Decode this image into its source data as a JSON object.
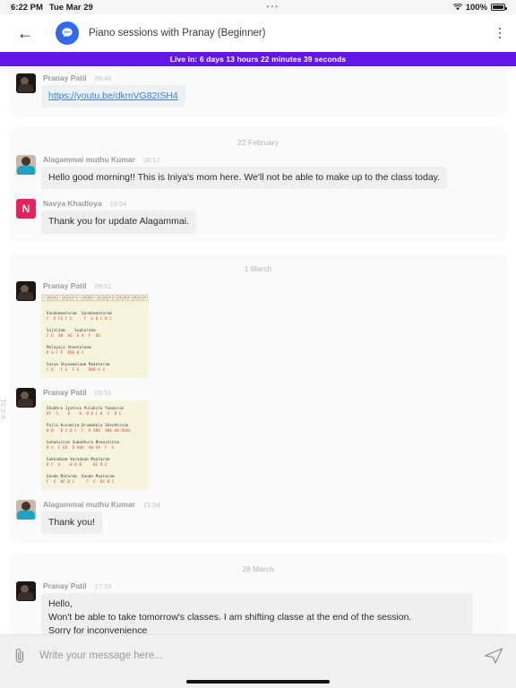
{
  "status_bar": {
    "time": "6:22 PM",
    "date": "Tue Mar 29",
    "center_dots": "•••",
    "battery_pct": "100%"
  },
  "header": {
    "back_icon": "back-arrow-icon",
    "app_icon": "chat-bubble-icon",
    "title": "Piano sessions with Pranay (Beginner)",
    "overflow_icon": "kebab-menu-icon"
  },
  "live_banner": {
    "text": "Live in: 6 days 13 hours 22 minutes 39 seconds",
    "color": "#6415e8"
  },
  "version_tag": "V-2.51",
  "conversation": {
    "groups": [
      {
        "date_label": null,
        "messages": [
          {
            "sender": "Pranay Patil",
            "time": "08:48",
            "avatar": "pranay",
            "type": "link",
            "text": "https://youtu.be/dkmVG82ISH4"
          }
        ]
      },
      {
        "date_label": "22 February",
        "messages": [
          {
            "sender": "Alagammai muthu Kumar",
            "time": "08:17",
            "avatar": "alagammai",
            "type": "text",
            "text": "Hello good morning!! This is Iniya's mom here. We'll not be able to make up to the class today."
          },
          {
            "sender": "Navya Khadloya",
            "time": "18:54",
            "avatar": "navya",
            "avatar_letter": "N",
            "avatar_color": "#e8215b",
            "type": "text",
            "text": "Thank you for update Alagammai."
          }
        ]
      },
      {
        "date_label": "1 March",
        "messages": [
          {
            "sender": "Pranay Patil",
            "time": "09:51",
            "avatar": "pranay",
            "type": "notation",
            "notation_id": "vandemaataram-sheet"
          },
          {
            "sender": "Pranay Patil",
            "time": "09:51",
            "avatar": "pranay",
            "type": "notation2",
            "notation_id": "shubhra-jyotsna-sheet"
          },
          {
            "sender": "Alagammai muthu Kumar",
            "time": "21:54",
            "avatar": "alagammai",
            "type": "text",
            "text": "Thank you!"
          }
        ]
      },
      {
        "date_label": "28 March",
        "messages": [
          {
            "sender": "Pranay Patil",
            "time": "17:23",
            "avatar": "pranay",
            "type": "text",
            "text": "Hello,\nWon't be able to take tomorrow's classes. I am shifting classe at the end of the session.\nSorry for inconvenience"
          }
        ]
      }
    ]
  },
  "notation_sheets": {
    "sheet1": {
      "keyboard_labels": [
        "C",
        "D",
        "E",
        "F",
        "G",
        "A",
        "B",
        "C",
        "D",
        "E",
        "F",
        "G",
        "A",
        "B",
        "C",
        "D",
        "E",
        "F",
        "G",
        "A",
        "B"
      ],
      "lines": [
        {
          "lyric": "Vandemaataram  Vandemaataram",
          "notes": "C  D FG F G     F  G B C B C"
        },
        {
          "lyric": "Sujalaam    Suphalaam",
          "notes": "C D  AB  AG  G A  F  ED"
        },
        {
          "lyric": "Malayaja Sheetalaam",
          "notes": "D G F F  EDE B C"
        },
        {
          "lyric": "Sasya Shyaamalaam Maaataram",
          "notes": "C D   F G  F G    DAB A G"
        }
      ]
    },
    "sheet2": {
      "lines": [
        {
          "lyric": "Shubhra Jyotsna Pulakita Yaaminim",
          "notes": "DF  G    B    B  B B C B  C  B C"
        },
        {
          "lyric": "Pulla Kusumita Drumadala Shoobhinim",
          "notes": "B B   B C B C  C  D ABA  ABA AB AGAG"
        },
        {
          "lyric": "Suhaasinim Sumadhura Bhaashinim",
          "notes": "D G  F ED  D ABA  AB GA  F  G"
        },
        {
          "lyric": "Sukhadaam Varadaam Maataram",
          "notes": "D F  G    B B B     BC B C"
        },
        {
          "lyric": "Vande Mataram  Vande Maataram",
          "notes": "F  G  BC B C     F  G  BC B C"
        }
      ]
    }
  },
  "composer": {
    "attach_icon": "paperclip-icon",
    "placeholder": "Write your message here...",
    "value": "",
    "send_icon": "send-plane-icon"
  }
}
